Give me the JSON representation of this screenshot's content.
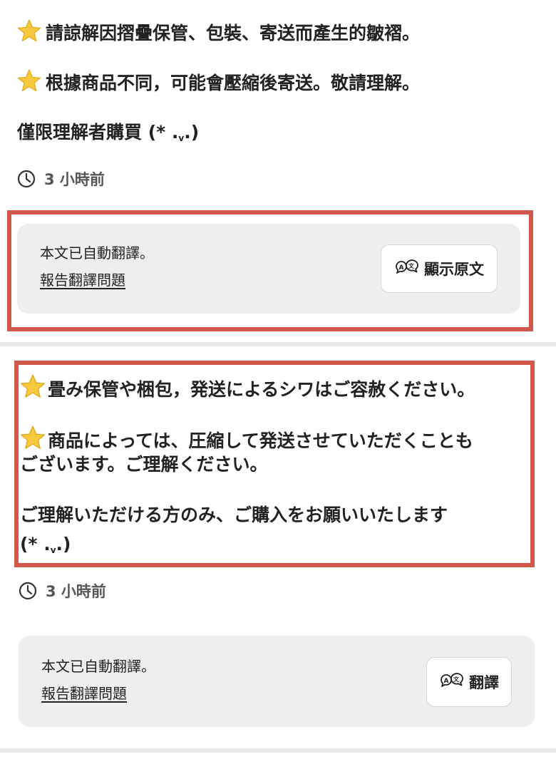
{
  "post1": {
    "line1": "請諒解因摺疊保管、包裝、寄送而產生的皺褶。",
    "line2": "根據商品不同，可能會壓縮後寄送。敬請理解。",
    "line3": "僅限理解者購買 (* ._.)",
    "line3_main": "僅限理解者購買 (* .",
    "line3_small": "v",
    "line3_end": ".)",
    "time": "3 小時前"
  },
  "card1": {
    "notice": "本文已自動翻譯。",
    "report_link": "報告翻譯問題",
    "button_label": "顯示原文"
  },
  "post2": {
    "line1": "畳み保管や梱包，発送によるシワはご容赦ください。",
    "line2a": "商品によっては、圧縮して発送させていただくことも",
    "line2b": "ございます。ご理解ください。",
    "line3a": "ご理解いただける方のみ、ご購入をお願いいたします",
    "line3b_main": "(* .",
    "line3b_small": "v",
    "line3b_end": ".)",
    "time": "3 小時前"
  },
  "card2": {
    "notice": "本文已自動翻譯。",
    "report_link": "報告翻譯問題",
    "button_label": "翻譯"
  },
  "colors": {
    "highlight_border": "#d1574a",
    "card_background": "#eeeeee",
    "star": "#f5c518"
  }
}
